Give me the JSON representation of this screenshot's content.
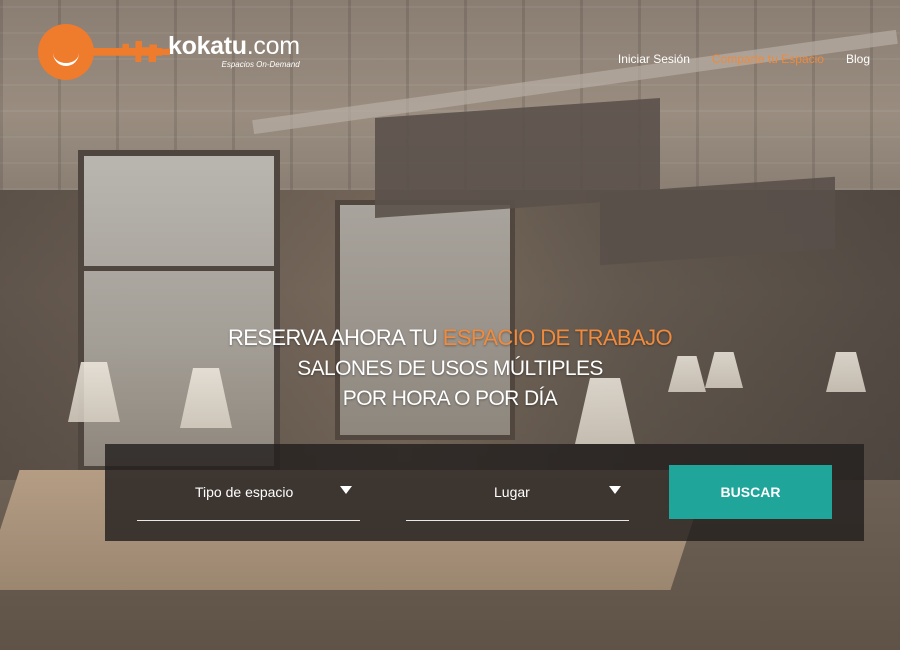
{
  "brand": {
    "name": "kokatu",
    "suffix": ".com",
    "tagline": "Espacios On-Demand",
    "color": "#ef7b2d"
  },
  "nav": {
    "items": [
      {
        "label": "Iniciar Sesión"
      },
      {
        "label": "Comparte tu Espacio"
      },
      {
        "label": "Blog"
      }
    ],
    "accent_color": "#f08a3c"
  },
  "hero": {
    "line1_prefix": "RESERVA AHORA TU ",
    "line1_highlight": "ESPACIO DE TRABAJO",
    "line2": "SALONES DE USOS MÚLTIPLES",
    "line3": "POR HORA O POR DÍA"
  },
  "search": {
    "type_label": "Tipo de espacio",
    "place_label": "Lugar",
    "button_label": "BUSCAR",
    "button_color": "#1fa59a"
  }
}
